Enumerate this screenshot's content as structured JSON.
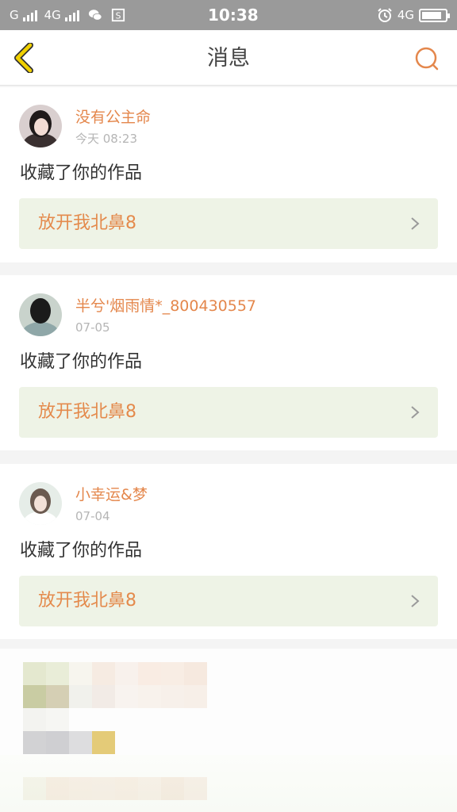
{
  "status_bar": {
    "carrier1": "G",
    "carrier2": "4G",
    "time": "10:38",
    "network_right": "4G",
    "battery_level": 0.85
  },
  "header": {
    "title": "消息"
  },
  "messages": [
    {
      "user": "没有公主命",
      "time": "今天 08:23",
      "action": "收藏了你的作品",
      "work": "放开我北鼻8"
    },
    {
      "user": "半兮'烟雨情*_800430557",
      "time": "07-05",
      "action": "收藏了你的作品",
      "work": "放开我北鼻8"
    },
    {
      "user": "小幸运&梦",
      "time": "07-04",
      "action": "收藏了你的作品",
      "work": "放开我北鼻8"
    }
  ],
  "colors": {
    "accent": "#e4874c",
    "back_icon": "#f0d000",
    "link_bg": "#eef3e6"
  }
}
